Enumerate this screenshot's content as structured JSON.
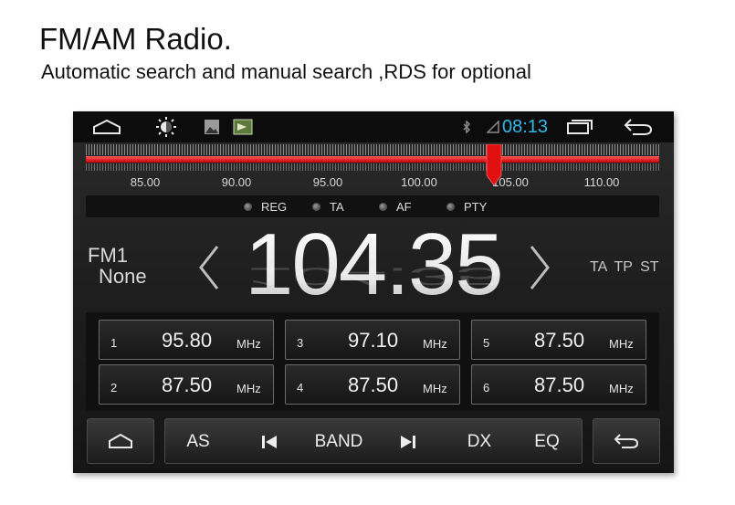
{
  "caption": {
    "title": "FM/AM Radio.",
    "subtitle": "Automatic search and manual search ,RDS for optional"
  },
  "status_bar": {
    "time": "08:13",
    "time_color": "#2fb8e8",
    "icons": [
      "home-outline-icon",
      "brightness-icon",
      "image-icon",
      "screenshot-icon",
      "bluetooth-icon",
      "signal-icon",
      "recent-apps-icon",
      "back-icon"
    ]
  },
  "tuner": {
    "scale_labels": [
      "85.00",
      "90.00",
      "95.00",
      "100.00",
      "105.00",
      "110.00"
    ],
    "needle_color": "#e01010",
    "current_mhz": 104.35
  },
  "flags": [
    "REG",
    "TA",
    "AF",
    "PTY"
  ],
  "station": {
    "band": "FM1",
    "name": "None",
    "frequency": "104.35",
    "rds_flags": "TA TP ST"
  },
  "presets": [
    {
      "num": "1",
      "freq": "95.80",
      "unit": "MHz"
    },
    {
      "num": "3",
      "freq": "97.10",
      "unit": "MHz"
    },
    {
      "num": "5",
      "freq": "87.50",
      "unit": "MHz"
    },
    {
      "num": "2",
      "freq": "87.50",
      "unit": "MHz"
    },
    {
      "num": "4",
      "freq": "87.50",
      "unit": "MHz"
    },
    {
      "num": "6",
      "freq": "87.50",
      "unit": "MHz"
    }
  ],
  "controls": {
    "as": "AS",
    "band": "BAND",
    "dx": "DX",
    "eq": "EQ"
  }
}
